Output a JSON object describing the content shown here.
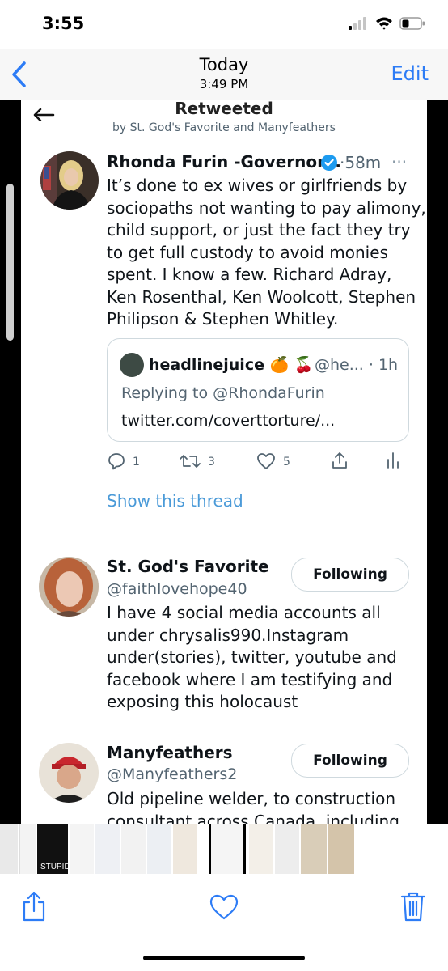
{
  "status_bar": {
    "time": "3:55"
  },
  "nav": {
    "title": "Today",
    "subtitle": "3:49 PM",
    "edit_label": "Edit"
  },
  "tweet_screen": {
    "header_title": "Retweeted",
    "header_sub": "by St. God's Favorite and Manyfeathers",
    "main_tweet": {
      "author": "Rhonda Furin -Governor...",
      "age": "·58m",
      "more": "···",
      "lines": [
        "It’s done to ex wives or girlfriends by",
        "sociopaths not wanting to pay alimony,",
        "child support, or just the fact they try",
        "to get full custody to avoid monies",
        "spent. I know a few. Richard Adray,",
        "Ken Rosenthal, Ken Woolcott, Stephen",
        "Philipson & Stephen Whitley."
      ],
      "quote": {
        "name": "headlinejuice 🍊 🍒",
        "handle": "@he... · 1h",
        "replying": "Replying to @RhondaFurin",
        "link": "twitter.com/coverttorture/..."
      },
      "counts": {
        "replies": "1",
        "retweets": "3",
        "likes": "5"
      },
      "show_thread": "Show this thread"
    },
    "accounts": [
      {
        "name": "St. God's Favorite",
        "handle": "@faithlovehope40",
        "button": "Following",
        "bio": [
          "I have 4 social media accounts all",
          "under chrysalis990.Instagram",
          "under(stories), twitter, youtube and",
          "facebook where I am testifying and",
          "exposing this holocaust"
        ]
      },
      {
        "name": "Manyfeathers",
        "handle": "@Manyfeathers2",
        "button": "Following",
        "bio": [
          "Old pipeline welder, to construction",
          "consultant across Canada, including"
        ]
      }
    ]
  },
  "thumbnails": {
    "stupid_text": "STUPIDI"
  },
  "colors": {
    "accent": "#2d7cf6",
    "link": "#4a9ad8",
    "verified": "#1d9bf0"
  }
}
